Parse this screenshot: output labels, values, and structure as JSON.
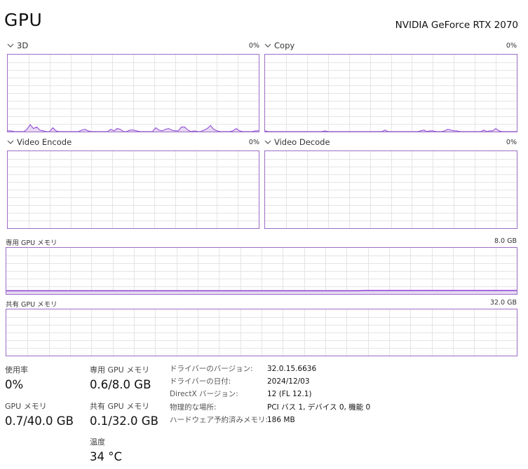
{
  "header": {
    "title": "GPU",
    "gpu_name": "NVIDIA GeForce RTX 2070"
  },
  "engines": [
    {
      "label": "3D",
      "value": "0%",
      "usage_pct": [
        1,
        1,
        0,
        0,
        0,
        0,
        3,
        9,
        4,
        6,
        2,
        1,
        0,
        0,
        5,
        1,
        0,
        0,
        0,
        0,
        0,
        0,
        0,
        2,
        3,
        1,
        0,
        0,
        0,
        0,
        0,
        0,
        3,
        1,
        4,
        3,
        0,
        0,
        2,
        2,
        1,
        0,
        0,
        0,
        0,
        0,
        5,
        2,
        1,
        3,
        4,
        2,
        1,
        1,
        6,
        6,
        2,
        0,
        1,
        0,
        0,
        2,
        4,
        8,
        3,
        1,
        0,
        0,
        0,
        0,
        1,
        4,
        1,
        0,
        0,
        0,
        0,
        1,
        1
      ]
    },
    {
      "label": "Copy",
      "value": "0%",
      "usage_pct": [
        1,
        0,
        0,
        0,
        0,
        0,
        0,
        0,
        0,
        0,
        0,
        0,
        0,
        0,
        0,
        0,
        0,
        0,
        0,
        0,
        1,
        0,
        0,
        0,
        0,
        0,
        0,
        0,
        0,
        0,
        0,
        0,
        0,
        0,
        0,
        0,
        0,
        0,
        0,
        0,
        2,
        0,
        0,
        0,
        0,
        0,
        0,
        0,
        0,
        0,
        0,
        0,
        1,
        2,
        0,
        1,
        1,
        0,
        0,
        0,
        1,
        3,
        2,
        1,
        1,
        0,
        0,
        0,
        0,
        0,
        0,
        0,
        0,
        2,
        0,
        1,
        1,
        4,
        1,
        0,
        0,
        0,
        0,
        0,
        0
      ]
    },
    {
      "label": "Video Encode",
      "value": "0%",
      "usage_pct": []
    },
    {
      "label": "Video Decode",
      "value": "0%",
      "usage_pct": []
    }
  ],
  "dedicated_mem": {
    "label": "専用 GPU メモリ",
    "max": "8.0 GB",
    "usage_pct": [
      7.0,
      7.0,
      7.0,
      7.0,
      7.0,
      7.0,
      7.0,
      7.0,
      7.0,
      7.0,
      7.0,
      7.0,
      7.0,
      7.0,
      7.0,
      7.0,
      7.0,
      7.0,
      7.0,
      7.0,
      7.0,
      7.0,
      7.0,
      7.0,
      7.0,
      7.0,
      7.0,
      7.0,
      7.0,
      7.0,
      7.0,
      7.0,
      7.0,
      7.0,
      7.0,
      7.0,
      7.0,
      7.0,
      7.0,
      7.0,
      7.0,
      7.0,
      7.0,
      7.0,
      7.0,
      7.0,
      7.0,
      7.0,
      7.0,
      7.0,
      7.0,
      7.0,
      7.5,
      7.5,
      7.5,
      7.5,
      7.5,
      7.5,
      7.5,
      7.5,
      7.5,
      7.5,
      7.5,
      7.5,
      7.5,
      7.5,
      7.5,
      7.5,
      7.5,
      7.5,
      7.5,
      7.5,
      7.5,
      7.5,
      7.5
    ]
  },
  "shared_mem": {
    "label": "共有 GPU メモリ",
    "max": "32.0 GB",
    "usage_pct": []
  },
  "stats": {
    "utilization": {
      "label": "使用率",
      "value": "0%"
    },
    "dedicated": {
      "label": "専用 GPU メモリ",
      "value": "0.6/8.0 GB"
    },
    "gpu_memory": {
      "label": "GPU メモリ",
      "value": "0.7/40.0 GB"
    },
    "shared": {
      "label": "共有 GPU メモリ",
      "value": "0.1/32.0 GB"
    },
    "temperature": {
      "label": "温度",
      "value": "34 °C"
    }
  },
  "info": [
    {
      "key": "ドライバーのバージョン:",
      "value": "32.0.15.6636"
    },
    {
      "key": "ドライバーの日付:",
      "value": "2024/12/03"
    },
    {
      "key": "DirectX バージョン:",
      "value": "12 (FL 12.1)"
    },
    {
      "key": "物理的な場所:",
      "value": "PCI バス 1, デバイス 0, 機能 0"
    },
    {
      "key": "ハードウェア予約済みメモリ:",
      "value": "186 MB"
    }
  ],
  "colors": {
    "accent": "#8b3fd1",
    "fill": "#e6d9f3",
    "border": "#9b6cc7",
    "grid": "#e4e4e4"
  }
}
